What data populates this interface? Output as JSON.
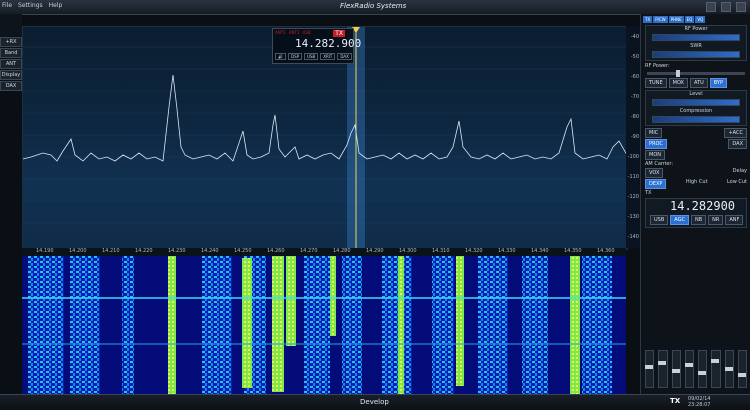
{
  "menu": [
    "File",
    "Settings",
    "Help"
  ],
  "app_title": "FlexRadio Systems",
  "left_buttons": [
    "+RX",
    "Band",
    "ANT",
    "Display",
    "DAX"
  ],
  "slice": {
    "frequency": "14.282.900",
    "tx_label": "TX",
    "tags": [
      "ANT1",
      "ANT1",
      "USB"
    ],
    "buttons": [
      "DSP",
      "USB",
      "XRIT",
      "DAX"
    ]
  },
  "db_labels": [
    "-40",
    "-50",
    "-60",
    "-70",
    "-80",
    "-90",
    "-100",
    "-110",
    "-120",
    "-130",
    "-140"
  ],
  "freq_ticks": [
    "14.190",
    "14.200",
    "14.210",
    "14.220",
    "14.230",
    "14.240",
    "14.250",
    "14.260",
    "14.270",
    "14.280",
    "14.290",
    "14.300",
    "14.310",
    "14.320",
    "14.330",
    "14.340",
    "14.350",
    "14.360"
  ],
  "right_panel": {
    "tabs": [
      "TX",
      "P/CW",
      "PHNE",
      "EQ",
      "VQ"
    ],
    "rf_power_label": "RF Power",
    "swr_label": "SWR",
    "rf_power_row": "RF Power:",
    "tune_buttons": [
      "TUNE",
      "MOX",
      "ATU",
      "BYP"
    ],
    "level_label": "Level",
    "compression_label": "Compression",
    "mic_label": "MIC",
    "acc_label": "+ACC",
    "proc_label": "PROC",
    "dax_label": "DAX",
    "mon_label": "MON",
    "am_carrier": "AM Carrier:",
    "vox_label": "VOX",
    "delay_label": "Delay",
    "dexp_label": "DEXP",
    "high_cut": "High Cut",
    "low_cut": "Low Cut",
    "tx_label": "TX",
    "vfo_frequency": "14.282900",
    "mode": "USB",
    "agc_labels": [
      "AGC",
      "NB",
      "NR",
      "ANF"
    ]
  },
  "bottom": {
    "label": "Develop",
    "tx": "TX",
    "date": "09/02/14",
    "time": "23:28:07"
  }
}
